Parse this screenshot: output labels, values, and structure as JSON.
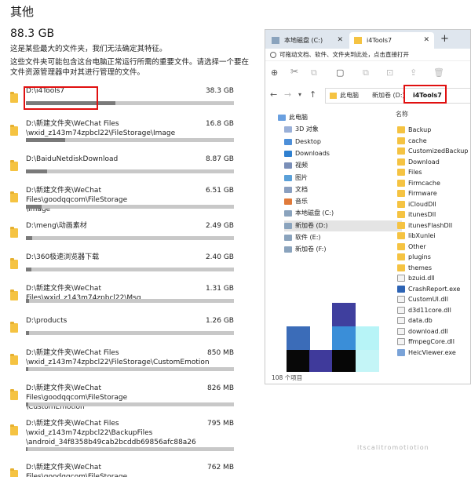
{
  "page": {
    "title": "其他",
    "total_size": "88.3 GB",
    "desc_line1": "这是某些最大的文件夹，我们无法确定其特征。",
    "desc_line2": "这些文件夹可能包含这台电脑正常运行所需的重要文件。请选择一个要在",
    "desc_line3": "文件资源管理器中对其进行管理的文件。"
  },
  "folders": [
    {
      "path": "D:\\i4Tools7",
      "size": "38.3 GB",
      "fill": 0.43
    },
    {
      "path": "D:\\新建文件夹\\WeChat Files\n\\wxid_z143m74zpbcl22\\FileStorage\\Image",
      "size": "16.8 GB",
      "fill": 0.19
    },
    {
      "path": "D:\\BaiduNetdiskDownload",
      "size": "8.87 GB",
      "fill": 0.1
    },
    {
      "path": "D:\\新建文件夹\\WeChat Files\\goodqqcom\\FileStorage\n\\Image",
      "size": "6.51 GB",
      "fill": 0.075
    },
    {
      "path": "D:\\meng\\动画素材",
      "size": "2.49 GB",
      "fill": 0.03
    },
    {
      "path": "D:\\360极速浏览器下载",
      "size": "2.40 GB",
      "fill": 0.028
    },
    {
      "path": "D:\\新建文件夹\\WeChat Files\\wxid_z143m74zpbcl22\\Msg",
      "size": "1.31 GB",
      "fill": 0.016
    },
    {
      "path": "D:\\products",
      "size": "1.26 GB",
      "fill": 0.015
    },
    {
      "path": "D:\\新建文件夹\\WeChat Files\n\\wxid_z143m74zpbcl22\\FileStorage\\CustomEmotion",
      "size": "850 MB",
      "fill": 0.01
    },
    {
      "path": "D:\\新建文件夹\\WeChat Files\\goodqqcom\\FileStorage\n\\CustomEmotion",
      "size": "826 MB",
      "fill": 0.01
    },
    {
      "path": "D:\\新建文件夹\\WeChat Files\n\\wxid_z143m74zpbcl22\\BackupFiles\n\\android_34f8358b49cab2bcddb69856afc88a26",
      "size": "795 MB",
      "fill": 0.009
    },
    {
      "path": "D:\\新建文件夹\\WeChat Files\\goodqqcom\\FileStorage\n\\File",
      "size": "762 MB",
      "fill": 0.009
    }
  ],
  "explorer": {
    "tab_inactive": "本地磁盘 (C:)",
    "tab_active": "i4Tools7",
    "tab_close": "✕",
    "new_tab": "+",
    "infobar": "可拖动文档、软件、文件夹到此处，点击直接打开",
    "crumbs": [
      "此电脑",
      "新加卷 (D:)",
      "i4Tools7"
    ],
    "tree": [
      "此电脑",
      "3D 对象",
      "Desktop",
      "Downloads",
      "视频",
      "图片",
      "文档",
      "音乐",
      "本地磁盘 (C:)",
      "新加卷 (D:)",
      "软件 (E:)",
      "新加卷 (F:)"
    ],
    "column_header": "名称",
    "files": [
      {
        "name": "Backup",
        "kind": "folder"
      },
      {
        "name": "cache",
        "kind": "folder"
      },
      {
        "name": "CustomizedBackup",
        "kind": "folder"
      },
      {
        "name": "Download",
        "kind": "folder"
      },
      {
        "name": "Files",
        "kind": "folder"
      },
      {
        "name": "Firmcache",
        "kind": "folder"
      },
      {
        "name": "Firmware",
        "kind": "folder"
      },
      {
        "name": "iCloudDll",
        "kind": "folder"
      },
      {
        "name": "itunesDll",
        "kind": "folder"
      },
      {
        "name": "itunesFlashDll",
        "kind": "folder"
      },
      {
        "name": "libXunlei",
        "kind": "folder"
      },
      {
        "name": "Other",
        "kind": "folder"
      },
      {
        "name": "plugins",
        "kind": "folder"
      },
      {
        "name": "themes",
        "kind": "folder"
      },
      {
        "name": "bzuid.dll",
        "kind": "file"
      },
      {
        "name": "CrashReport.exe",
        "kind": "exe"
      },
      {
        "name": "CustomUI.dll",
        "kind": "file"
      },
      {
        "name": "d3d11core.dll",
        "kind": "file"
      },
      {
        "name": "data.db",
        "kind": "file"
      },
      {
        "name": "download.dll",
        "kind": "file"
      },
      {
        "name": "ffmpegCore.dll",
        "kind": "file"
      },
      {
        "name": "HeicViewer.exe",
        "kind": "app"
      }
    ],
    "status": "108 个项目"
  },
  "colors": {
    "highlight": "#e01010",
    "folder": "#f5c342",
    "bar_track": "#c8c8c8",
    "bar_fill": "#7a7a7a"
  }
}
